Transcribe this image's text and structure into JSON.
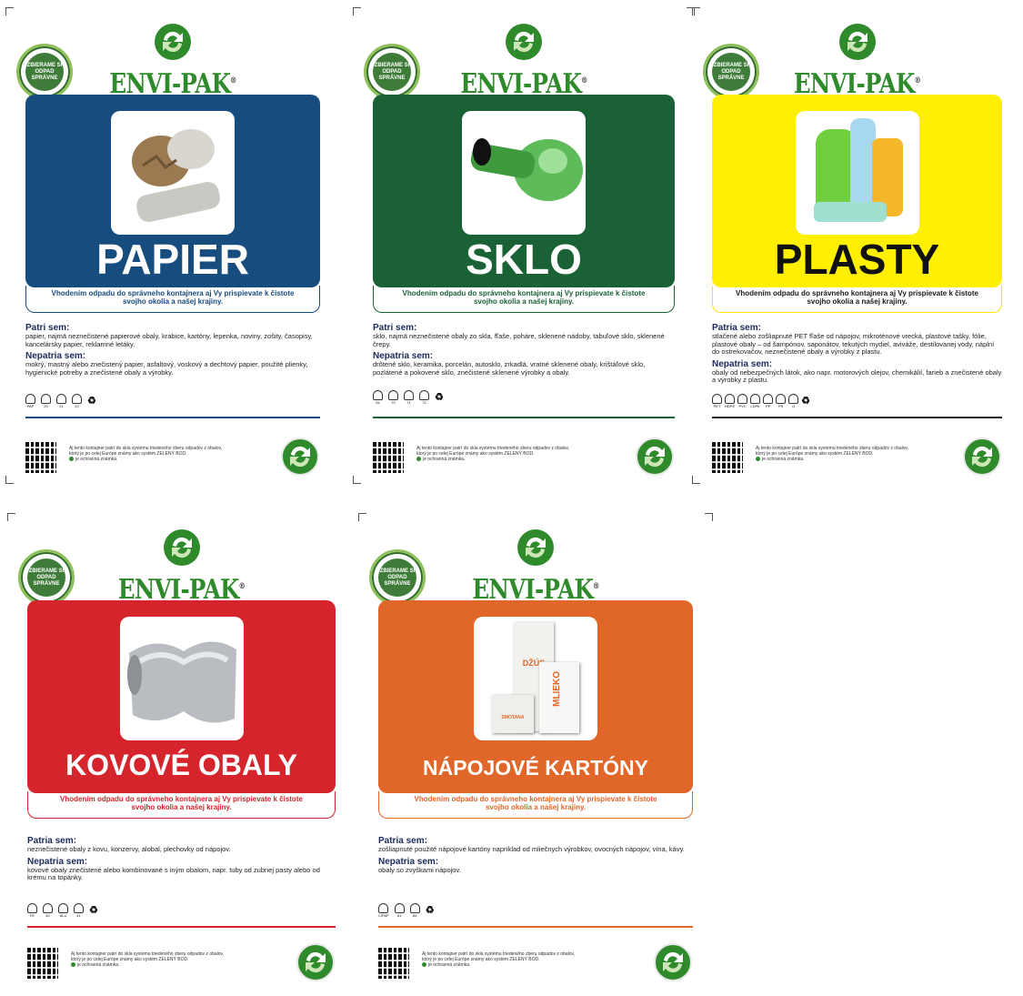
{
  "brand": "ENVI-PAK",
  "brand_mark": "®",
  "seal_text": "ZBIERAME SI ODPAD SPRÁVNE",
  "slogan_line1": "Vhodením odpadu do správneho kontajnera aj Vy prispievate k čistote",
  "slogan_line2": "svojho okolia a našej krajiny.",
  "footer_text1": "Aj tento kontajner patrí do skla systému triedeného zberu odpadov z obalov,",
  "footer_text2": "ktorý je po celej Európe známy ako systém ZELENÝ BOD.",
  "footer_text3": "je ochranná známka.",
  "posters": [
    {
      "title": "PAPIER",
      "color": "#174c7f",
      "title_color": "#ffffff",
      "patria_label": "Patri sem:",
      "patria_text": "papier, najmä neznečistené papierové obaly, krabice, kartóny, lepenka, noviny, zošity, časopisy, kancelársky papier, reklamné letáky.",
      "nepatria_label": "Nepatria sem:",
      "nepatria_text": "mokrý, mastný alebo znečistený papier, asfaltový, voskový a dechtový papier, použité plienky, hygienické potreby a znečistené obaly a výrobky.",
      "codes": [
        "PAP",
        "20",
        "21",
        "22"
      ],
      "photo": "paper-icon"
    },
    {
      "title": "SKLO",
      "color": "#1a6236",
      "title_color": "#ffffff",
      "patria_label": "Patri sem:",
      "patria_text": "sklo, najmä neznečistené obaly zo skla, fľaše, poháre, sklenené nádoby, tabuľové sklo, sklenené črepy.",
      "nepatria_label": "Nepatria sem:",
      "nepatria_text": "drôtené sklo, keramika, porcelán, autosklo, zrkadlá, vratné sklenené obaly, krištáľové sklo, pozlátené a pokovené sklo, znečistené sklenené výrobky a obaly.",
      "codes": [
        "GL",
        "70",
        "71",
        "72"
      ],
      "photo": "bottle-icon"
    },
    {
      "title": "PLASTY",
      "color": "#ffef00",
      "title_color": "#111111",
      "patria_label": "Patria sem:",
      "patria_text": "stlačené alebo zošliapnuté PET fľaše od nápojov, mikroténové vrecká, plastové tašky, fólie, plastové obaly – od šampónov, saponátov, tekutých mydiel, aviváže, destilovanej vody, náplní do ostrekovačov, neznečistené obaly a výrobky z plastu.",
      "nepatria_label": "Nepatria sem:",
      "nepatria_text": "obaly od nebezpečných látok, ako napr. motorových olejov, chemikálií, farieb a znečistené obaly a výrobky z plastu.",
      "codes": [
        "PET",
        "HDPE",
        "PVC",
        "LDPE",
        "PP",
        "PS",
        "O"
      ],
      "photo": "plastic-icon"
    },
    {
      "title": "KOVOVÉ OBALY",
      "color": "#d5242c",
      "title_color": "#ffffff",
      "patria_label": "Patria sem:",
      "patria_text": "neznečistené obaly z kovu, konzervy, alobal, plechovky od nápojov.",
      "nepatria_label": "Nepatria sem:",
      "nepatria_text": "kovové obaly znečistené alebo kombinované s iným obalom, napr. tuby od zubnej pasty alebo od krému na topánky.",
      "codes": [
        "FE",
        "40",
        "ALU",
        "41"
      ],
      "photo": "can-icon"
    },
    {
      "title": "NÁPOJOVÉ KARTÓNY",
      "color": "#e0662a",
      "title_color": "#ffffff",
      "patria_label": "Patria sem:",
      "patria_text": "zošliapnuté použité nápojové kartóny napríklad od mliečnych výrobkov, ovocných nápojov, vína, kávy.",
      "nepatria_label": "Nepatria sem:",
      "nepatria_text": "obaly so zvyškami nápojov.",
      "codes": [
        "C/PAP",
        "81",
        "84"
      ],
      "photo": "carton-icon",
      "carton_labels": [
        "DŽÚS",
        "MLIEKO",
        "SMOTANA"
      ]
    }
  ]
}
